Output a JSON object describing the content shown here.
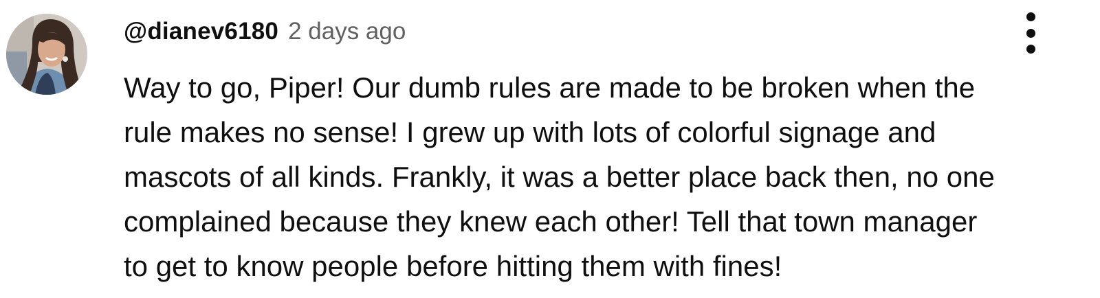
{
  "comment": {
    "author_handle": "@dianev6180",
    "timestamp": "2 days ago",
    "avatar": "profile-photo",
    "menu_icon": "more-vertical-icon",
    "text_lines": [
      "Way to go, Piper! Our dumb rules are made to be broken when the",
      "rule makes no sense! I grew up with lots of colorful signage and",
      "mascots of all kinds. Frankly, it was a better place back then, no one",
      "complained because they knew each other! Tell that town manager",
      "to get to know people before hitting them with fines!"
    ]
  },
  "colors": {
    "text_primary": "#0f0f0f",
    "text_secondary": "#606060",
    "background": "#ffffff"
  }
}
